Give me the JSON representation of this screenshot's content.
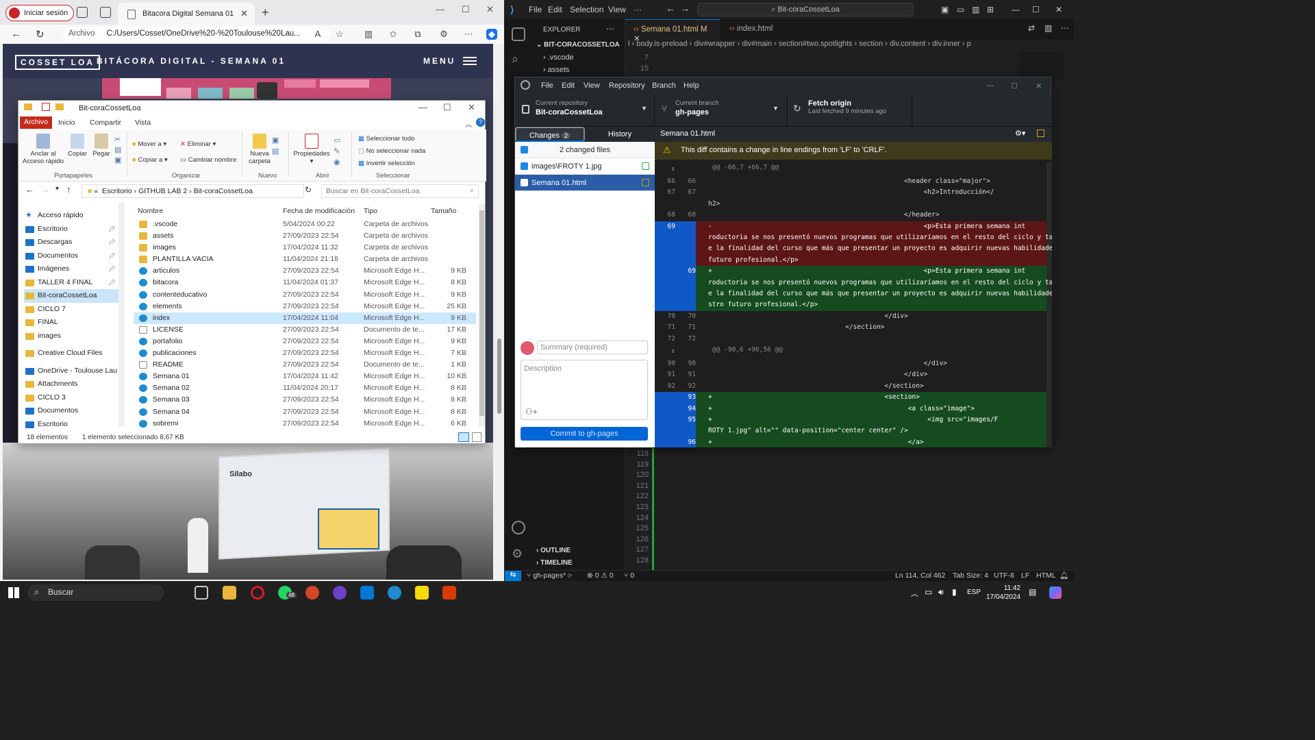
{
  "browser": {
    "signin": "Iniciar sesión",
    "tab_title": "Bitacora Digital Semana 01",
    "addr_label": "Archivo",
    "url": "C:/Users/Cosset/OneDrive%20-%20Toulouse%20Lau...",
    "site": {
      "logo": "COSSET LOA",
      "title": "BITÁCORA DIGITAL - SEMANA 01",
      "menu": "MENU",
      "slide_title": "Silabo"
    }
  },
  "explorer": {
    "title": "Bit-coraCossetLoa",
    "tabs": [
      "Archivo",
      "Inicio",
      "Compartir",
      "Vista"
    ],
    "ribbon": {
      "anclar": "Anclar al Acceso rápido",
      "copiar": "Copiar",
      "pegar": "Pegar",
      "mover": "Mover a",
      "copiar_a": "Copiar a",
      "eliminar": "Eliminar",
      "cambiar": "Cambiar nombre",
      "nueva": "Nueva carpeta",
      "propiedades": "Propiedades",
      "sel_todo": "Seleccionar todo",
      "no_sel": "No seleccionar nada",
      "invertir": "Invertir selección",
      "groups": [
        "Portapapeles",
        "Organizar",
        "Nuevo",
        "Abrir",
        "Seleccionar"
      ]
    },
    "path": [
      "Escritorio",
      "GITHUB LAB 2",
      "Bit-coraCossetLoa"
    ],
    "path_prefix": "«",
    "search_placeholder": "Buscar en Bit-coraCossetLoa",
    "nav": [
      {
        "label": "Acceso rápido",
        "kind": "star"
      },
      {
        "label": "Escritorio",
        "kind": "blue"
      },
      {
        "label": "Descargas",
        "kind": "blue"
      },
      {
        "label": "Documentos",
        "kind": "blue"
      },
      {
        "label": "Imágenes",
        "kind": "blue"
      },
      {
        "label": "TALLER 4 FINAL",
        "kind": "folder"
      },
      {
        "label": "Bit-coraCossetLoa",
        "kind": "folder"
      },
      {
        "label": "CICLO 7",
        "kind": "folder"
      },
      {
        "label": "FINAL",
        "kind": "folder"
      },
      {
        "label": "images",
        "kind": "folder"
      },
      {
        "label": "Creative Cloud Files",
        "kind": "folder"
      },
      {
        "label": "OneDrive - Toulouse Lau",
        "kind": "blue"
      },
      {
        "label": "Attachments",
        "kind": "folder"
      },
      {
        "label": "CICLO 3",
        "kind": "folder"
      },
      {
        "label": "Documentos",
        "kind": "blue"
      },
      {
        "label": "Escritorio",
        "kind": "blue"
      }
    ],
    "columns": [
      "Nombre",
      "Fecha de modificación",
      "Tipo",
      "Tamaño"
    ],
    "files": [
      {
        "name": ".vscode",
        "date": "5/04/2024 00:22",
        "type": "Carpeta de archivos",
        "size": "",
        "icon": "folder"
      },
      {
        "name": "assets",
        "date": "27/09/2023 22:54",
        "type": "Carpeta de archivos",
        "size": "",
        "icon": "folder"
      },
      {
        "name": "images",
        "date": "17/04/2024 11:32",
        "type": "Carpeta de archivos",
        "size": "",
        "icon": "folder"
      },
      {
        "name": "PLANTILLA VACIA",
        "date": "11/04/2024 21:18",
        "type": "Carpeta de archivos",
        "size": "",
        "icon": "folder"
      },
      {
        "name": "articulos",
        "date": "27/09/2023 22:54",
        "type": "Microsoft Edge H...",
        "size": "9 KB",
        "icon": "edge"
      },
      {
        "name": "bitacora",
        "date": "11/04/2024 01:37",
        "type": "Microsoft Edge H...",
        "size": "8 KB",
        "icon": "edge"
      },
      {
        "name": "contenteducativo",
        "date": "27/09/2023 22:54",
        "type": "Microsoft Edge H...",
        "size": "9 KB",
        "icon": "edge"
      },
      {
        "name": "elements",
        "date": "27/09/2023 22:54",
        "type": "Microsoft Edge H...",
        "size": "25 KB",
        "icon": "edge"
      },
      {
        "name": "index",
        "date": "17/04/2024 11:04",
        "type": "Microsoft Edge H...",
        "size": "9 KB",
        "icon": "edge"
      },
      {
        "name": "LICENSE",
        "date": "27/09/2023 22:54",
        "type": "Documento de te...",
        "size": "17 KB",
        "icon": "doc"
      },
      {
        "name": "portafolio",
        "date": "27/09/2023 22:54",
        "type": "Microsoft Edge H...",
        "size": "9 KB",
        "icon": "edge"
      },
      {
        "name": "publicaciones",
        "date": "27/09/2023 22:54",
        "type": "Microsoft Edge H...",
        "size": "7 KB",
        "icon": "edge"
      },
      {
        "name": "README",
        "date": "27/09/2023 22:54",
        "type": "Documento de te...",
        "size": "1 KB",
        "icon": "doc"
      },
      {
        "name": "Semana 01",
        "date": "17/04/2024 11:42",
        "type": "Microsoft Edge H...",
        "size": "10 KB",
        "icon": "edge"
      },
      {
        "name": "Semana 02",
        "date": "11/04/2024 20:17",
        "type": "Microsoft Edge H...",
        "size": "8 KB",
        "icon": "edge"
      },
      {
        "name": "Semana 03",
        "date": "27/09/2023 22:54",
        "type": "Microsoft Edge H...",
        "size": "8 KB",
        "icon": "edge"
      },
      {
        "name": "Semana 04",
        "date": "27/09/2023 22:54",
        "type": "Microsoft Edge H...",
        "size": "8 KB",
        "icon": "edge"
      },
      {
        "name": "sobremi",
        "date": "27/09/2023 22:54",
        "type": "Microsoft Edge H...",
        "size": "6 KB",
        "icon": "edge"
      }
    ],
    "selected_file": "index",
    "status_count": "18 elementos",
    "status_sel": "1 elemento seleccionado  8,67 KB"
  },
  "vscode": {
    "menu": [
      "File",
      "Edit",
      "Selection",
      "View",
      "···"
    ],
    "search": "Bit-coraCossetLoa",
    "explorer_label": "EXPLORER",
    "root": "BIT-CORACOSSETLOA",
    "tree": [
      ".vscode",
      "assets"
    ],
    "outline": "OUTLINE",
    "timeline": "TIMELINE",
    "tabs": [
      {
        "label": "Semana 01.html",
        "flag": "M"
      },
      {
        "label": "index.html",
        "flag": ""
      }
    ],
    "breadcrumb": "l › body.is-preload › div#wrapper › div#main › section#two.spotlights › section › div.content › div.inner › p",
    "top_lines": [
      "7",
      "15"
    ],
    "bottom_lines": [
      "118",
      "119",
      "120",
      "121",
      "122",
      "123",
      "124",
      "125",
      "126",
      "127",
      "128"
    ],
    "status": {
      "branch": "gh-pages*",
      "problems": "⊗ 0 ⚠ 0",
      "ports": "⑂ 0",
      "position": "Ln 114, Col 462",
      "tab": "Tab Size: 4",
      "enc": "UTF-8",
      "eol": "LF",
      "lang": "HTML"
    }
  },
  "github": {
    "menu": [
      "File",
      "Edit",
      "View",
      "Repository",
      "Branch",
      "Help"
    ],
    "repo_key": "Current repository",
    "repo_val": "Bit-coraCossetLoa",
    "branch_key": "Current branch",
    "branch_val": "gh-pages",
    "fetch_key": "Fetch origin",
    "fetch_val": "Last fetched 9 minutes ago",
    "tab_changes": "Changes",
    "changes_count": "2",
    "tab_history": "History",
    "changed_files": "2 changed files",
    "files": [
      {
        "name": "images\\FROTY 1.jpg",
        "status": "added"
      },
      {
        "name": "Semana 01.html",
        "status": "modified"
      }
    ],
    "summary_placeholder": "Summary (required)",
    "description_placeholder": "Description",
    "commit_label": "Commit to gh-pages",
    "diff_file": "Semana 01.html",
    "warning": "This diff contains a change in line endings from 'LF' to 'CRLF'.",
    "diff": [
      {
        "kind": "hunk",
        "a": "",
        "b": "",
        "text": "@@ -66,7 +66,7 @@"
      },
      {
        "kind": "ctx",
        "a": "66",
        "b": "66",
        "text": "                                                  <header class=\"major\">"
      },
      {
        "kind": "ctx",
        "a": "67",
        "b": "67",
        "text": "                                                       <h2>Introducción</"
      },
      {
        "kind": "ctx",
        "a": "",
        "b": "",
        "text": "h2>"
      },
      {
        "kind": "ctx",
        "a": "68",
        "b": "68",
        "text": "                                                  </header>"
      },
      {
        "kind": "del",
        "a": "69",
        "b": "",
        "text": "-                                                      <p>Esta primera semana int"
      },
      {
        "kind": "del",
        "a": "",
        "b": "",
        "text": "roductoria se nos presentó nuevos programas que utilizaríamos en el resto del ciclo y también sobr"
      },
      {
        "kind": "del",
        "a": "",
        "b": "",
        "text": "e la finalidad del curso que más que presentar un proyecto es adquirir nuevas habilidades para el"
      },
      {
        "kind": "del",
        "a": "",
        "b": "",
        "text": "futuro profesional.</p>"
      },
      {
        "kind": "add",
        "a": "",
        "b": "69",
        "text": "+                                                      <p>Esta primera semana int"
      },
      {
        "kind": "add",
        "a": "",
        "b": "",
        "text": "roductoria se nos presentó nuevos programas que utilizaríamos en el resto del ciclo y también sobr"
      },
      {
        "kind": "add",
        "a": "",
        "b": "",
        "text": "e la finalidad del curso que más que presentar un proyecto es adquirir nuevas habilidades para nue"
      },
      {
        "kind": "add",
        "a": "",
        "b": "",
        "text": "stro futuro profesional.</p>"
      },
      {
        "kind": "ctx",
        "a": "70",
        "b": "70",
        "text": "                                             </div>"
      },
      {
        "kind": "ctx",
        "a": "71",
        "b": "71",
        "text": "                                   </section>"
      },
      {
        "kind": "ctx",
        "a": "72",
        "b": "72",
        "text": ""
      },
      {
        "kind": "hunk",
        "a": "",
        "b": "",
        "text": "@@ -90,6 +90,56 @@"
      },
      {
        "kind": "ctx",
        "a": "90",
        "b": "90",
        "text": "                                                       </div>"
      },
      {
        "kind": "ctx",
        "a": "91",
        "b": "91",
        "text": "                                                  </div>"
      },
      {
        "kind": "ctx",
        "a": "92",
        "b": "92",
        "text": "                                             </section>"
      },
      {
        "kind": "add",
        "a": "",
        "b": "93",
        "text": "+                                            <section>"
      },
      {
        "kind": "add",
        "a": "",
        "b": "94",
        "text": "+                                                  <a class=\"image\">"
      },
      {
        "kind": "add",
        "a": "",
        "b": "95",
        "text": "+                                                       <img src=\"images/F"
      },
      {
        "kind": "add",
        "a": "",
        "b": "",
        "text": "ROTY 1.jpg\" alt=\"\" data-position=\"center center\" />"
      },
      {
        "kind": "add",
        "a": "",
        "b": "96",
        "text": "+                                                  </a>"
      }
    ]
  },
  "taskbar": {
    "search": "Buscar",
    "whatsapp_badge": "48",
    "lang": "ESP",
    "time": "11:42",
    "date": "17/04/2024"
  }
}
